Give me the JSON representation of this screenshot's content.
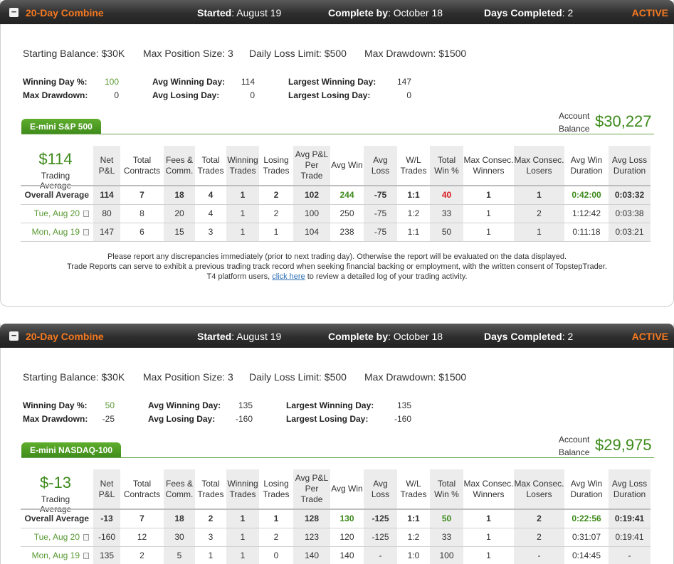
{
  "combines": [
    {
      "header": {
        "toggle": "−",
        "title": "20-Day Combine",
        "started_label": "Started",
        "started_value": ": August 19",
        "complete_label": "Complete by",
        "complete_value": ": October 18",
        "days_label": "Days Completed",
        "days_value": ": 2",
        "status": "ACTIVE"
      },
      "params": {
        "starting_balance": "Starting Balance: $30K",
        "max_position": "Max Position Size: 3",
        "daily_loss": "Daily Loss Limit: $500",
        "max_drawdown": "Max Drawdown: $1500"
      },
      "stats": {
        "winning_day_pct_label": "Winning Day %:",
        "winning_day_pct": "100",
        "max_drawdown_label": "Max Drawdown:",
        "max_drawdown": "0",
        "avg_winning_day_label": "Avg Winning Day:",
        "avg_winning_day": "114",
        "avg_losing_day_label": "Avg Losing Day:",
        "avg_losing_day": "0",
        "largest_winning_day_label": "Largest Winning Day:",
        "largest_winning_day": "147",
        "largest_losing_day_label": "Largest Losing Day:",
        "largest_losing_day": "0"
      },
      "product_tab": "E-mini S&P 500",
      "account_label_1": "Account",
      "account_label_2": "Balance",
      "account_balance": "$30,227",
      "trading_average_value": "$114",
      "trading_average_label": "Trading Average",
      "columns": [
        "Net P&L",
        "Total Contracts",
        "Fees & Comm.",
        "Total Trades",
        "Winning Trades",
        "Losing Trades",
        "Avg P&L Per Trade",
        "Avg Win",
        "Avg Loss",
        "W/L Trades",
        "Total Win %",
        "Max Consec. Winners",
        "Max Consec. Losers",
        "Avg Win Duration",
        "Avg Loss Duration"
      ],
      "overall": {
        "label": "Overall Average",
        "cells": [
          "114",
          "7",
          "18",
          "4",
          "1",
          "2",
          "102",
          "244",
          "-75",
          "1:1",
          "40",
          "1",
          "1",
          "0:42:00",
          "0:03:32"
        ]
      },
      "days": [
        {
          "label": "Tue, Aug 20",
          "cells": [
            "80",
            "8",
            "20",
            "4",
            "1",
            "2",
            "100",
            "250",
            "-75",
            "1:2",
            "33",
            "1",
            "2",
            "1:12:42",
            "0:03:38"
          ]
        },
        {
          "label": "Mon, Aug 19",
          "cells": [
            "147",
            "6",
            "15",
            "3",
            "1",
            "1",
            "104",
            "238",
            "-75",
            "1:1",
            "50",
            "1",
            "1",
            "0:11:18",
            "0:03:21"
          ]
        }
      ],
      "footer": {
        "line1": "Please report any discrepancies immediately (prior to next trading day). Otherwise the report will be evaluated on the data displayed.",
        "line2": "Trade Reports can serve to exhibit a previous trading track record when seeking financial backing or employment, with the written consent of TopstepTrader.",
        "line3_pre": "T4 platform users, ",
        "line3_link": "click here",
        "line3_post": " to review a detailed log of your trading activity."
      }
    },
    {
      "header": {
        "toggle": "−",
        "title": "20-Day Combine",
        "started_label": "Started",
        "started_value": ": August 19",
        "complete_label": "Complete by",
        "complete_value": ": October 18",
        "days_label": "Days Completed",
        "days_value": ": 2",
        "status": "ACTIVE"
      },
      "params": {
        "starting_balance": "Starting Balance: $30K",
        "max_position": "Max Position Size: 3",
        "daily_loss": "Daily Loss Limit: $500",
        "max_drawdown": "Max Drawdown: $1500"
      },
      "stats": {
        "winning_day_pct_label": "Winning Day %:",
        "winning_day_pct": "50",
        "max_drawdown_label": "Max Drawdown:",
        "max_drawdown": "-25",
        "avg_winning_day_label": "Avg Winning Day:",
        "avg_winning_day": "135",
        "avg_losing_day_label": "Avg Losing Day:",
        "avg_losing_day": "-160",
        "largest_winning_day_label": "Largest Winning Day:",
        "largest_winning_day": "135",
        "largest_losing_day_label": "Largest Losing Day:",
        "largest_losing_day": "-160"
      },
      "product_tab": "E-mini NASDAQ-100",
      "account_label_1": "Account",
      "account_label_2": "Balance",
      "account_balance": "$29,975",
      "trading_average_value": "$-13",
      "trading_average_label": "Trading Average",
      "columns": [
        "Net P&L",
        "Total Contracts",
        "Fees & Comm.",
        "Total Trades",
        "Winning Trades",
        "Losing Trades",
        "Avg P&L Per Trade",
        "Avg Win",
        "Avg Loss",
        "W/L Trades",
        "Total Win %",
        "Max Consec. Winners",
        "Max Consec. Losers",
        "Avg Win Duration",
        "Avg Loss Duration"
      ],
      "overall": {
        "label": "Overall Average",
        "cells": [
          "-13",
          "7",
          "18",
          "2",
          "1",
          "1",
          "128",
          "130",
          "-125",
          "1:1",
          "50",
          "1",
          "2",
          "0:22:56",
          "0:19:41"
        ]
      },
      "days": [
        {
          "label": "Tue, Aug 20",
          "cells": [
            "-160",
            "12",
            "30",
            "3",
            "1",
            "2",
            "123",
            "120",
            "-125",
            "1:2",
            "33",
            "1",
            "2",
            "0:31:07",
            "0:19:41"
          ]
        },
        {
          "label": "Mon, Aug 19",
          "cells": [
            "135",
            "2",
            "5",
            "1",
            "1",
            "0",
            "140",
            "140",
            "-",
            "1:0",
            "100",
            "1",
            "-",
            "0:14:45",
            "-"
          ]
        }
      ]
    }
  ],
  "colors": {
    "accent_orange": "#f47920",
    "green": "#3d8a1b",
    "red": "#d9141b"
  }
}
